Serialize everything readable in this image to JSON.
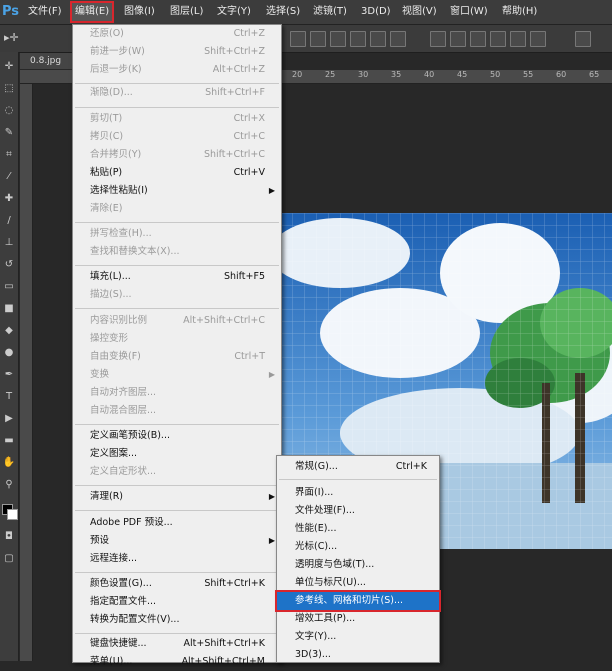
{
  "app_logo": "Ps",
  "menubar": [
    {
      "label": "文件(F)",
      "active": false
    },
    {
      "label": "编辑(E)",
      "active": true
    },
    {
      "label": "图像(I)",
      "active": false
    },
    {
      "label": "图层(L)",
      "active": false
    },
    {
      "label": "文字(Y)",
      "active": false
    },
    {
      "label": "选择(S)",
      "active": false
    },
    {
      "label": "滤镜(T)",
      "active": false
    },
    {
      "label": "3D(D)",
      "active": false
    },
    {
      "label": "视图(V)",
      "active": false
    },
    {
      "label": "窗口(W)",
      "active": false
    },
    {
      "label": "帮助(H)",
      "active": false
    }
  ],
  "document": {
    "tab_label": "0.8.jpg"
  },
  "ruler_ticks": [
    "20",
    "25",
    "30",
    "35",
    "40",
    "45",
    "50",
    "55",
    "60",
    "65"
  ],
  "edit_menu": [
    {
      "label": "还原(O)",
      "shortcut": "Ctrl+Z",
      "disabled": true
    },
    {
      "label": "前进一步(W)",
      "shortcut": "Shift+Ctrl+Z",
      "disabled": true
    },
    {
      "label": "后退一步(K)",
      "shortcut": "Alt+Ctrl+Z",
      "disabled": true
    },
    {
      "sep": true
    },
    {
      "label": "渐隐(D)...",
      "shortcut": "Shift+Ctrl+F",
      "disabled": true
    },
    {
      "sep": true
    },
    {
      "label": "剪切(T)",
      "shortcut": "Ctrl+X",
      "disabled": true
    },
    {
      "label": "拷贝(C)",
      "shortcut": "Ctrl+C",
      "disabled": true
    },
    {
      "label": "合并拷贝(Y)",
      "shortcut": "Shift+Ctrl+C",
      "disabled": true
    },
    {
      "label": "粘贴(P)",
      "shortcut": "Ctrl+V",
      "disabled": false
    },
    {
      "label": "选择性粘贴(I)",
      "shortcut": "",
      "disabled": false,
      "submenu": true
    },
    {
      "label": "清除(E)",
      "shortcut": "",
      "disabled": true
    },
    {
      "sep": true
    },
    {
      "label": "拼写检查(H)...",
      "shortcut": "",
      "disabled": true
    },
    {
      "label": "查找和替换文本(X)...",
      "shortcut": "",
      "disabled": true
    },
    {
      "sep": true
    },
    {
      "label": "填充(L)...",
      "shortcut": "Shift+F5",
      "disabled": false
    },
    {
      "label": "描边(S)...",
      "shortcut": "",
      "disabled": true
    },
    {
      "sep": true
    },
    {
      "label": "内容识别比例",
      "shortcut": "Alt+Shift+Ctrl+C",
      "disabled": true
    },
    {
      "label": "操控变形",
      "shortcut": "",
      "disabled": true
    },
    {
      "label": "自由变换(F)",
      "shortcut": "Ctrl+T",
      "disabled": true
    },
    {
      "label": "变换",
      "shortcut": "",
      "disabled": true,
      "submenu": true
    },
    {
      "label": "自动对齐图层...",
      "shortcut": "",
      "disabled": true
    },
    {
      "label": "自动混合图层...",
      "shortcut": "",
      "disabled": true
    },
    {
      "sep": true
    },
    {
      "label": "定义画笔预设(B)...",
      "shortcut": "",
      "disabled": false
    },
    {
      "label": "定义图案...",
      "shortcut": "",
      "disabled": false
    },
    {
      "label": "定义自定形状...",
      "shortcut": "",
      "disabled": true
    },
    {
      "sep": true
    },
    {
      "label": "清理(R)",
      "shortcut": "",
      "disabled": false,
      "submenu": true
    },
    {
      "sep": true
    },
    {
      "label": "Adobe PDF 预设...",
      "shortcut": "",
      "disabled": false
    },
    {
      "label": "预设",
      "shortcut": "",
      "disabled": false,
      "submenu": true
    },
    {
      "label": "远程连接...",
      "shortcut": "",
      "disabled": false
    },
    {
      "sep": true
    },
    {
      "label": "颜色设置(G)...",
      "shortcut": "Shift+Ctrl+K",
      "disabled": false
    },
    {
      "label": "指定配置文件...",
      "shortcut": "",
      "disabled": false
    },
    {
      "label": "转换为配置文件(V)...",
      "shortcut": "",
      "disabled": false
    },
    {
      "sep": true
    },
    {
      "label": "键盘快捷键...",
      "shortcut": "Alt+Shift+Ctrl+K",
      "disabled": false
    },
    {
      "label": "菜单(U)...",
      "shortcut": "Alt+Shift+Ctrl+M",
      "disabled": false
    }
  ],
  "preferences_submenu": [
    {
      "label": "常规(G)...",
      "shortcut": "Ctrl+K",
      "highlighted": false
    },
    {
      "sep": true
    },
    {
      "label": "界面(I)...",
      "shortcut": "",
      "highlighted": false
    },
    {
      "label": "文件处理(F)...",
      "shortcut": "",
      "highlighted": false
    },
    {
      "label": "性能(E)...",
      "shortcut": "",
      "highlighted": false
    },
    {
      "label": "光标(C)...",
      "shortcut": "",
      "highlighted": false
    },
    {
      "label": "透明度与色域(T)...",
      "shortcut": "",
      "highlighted": false
    },
    {
      "label": "单位与标尺(U)...",
      "shortcut": "",
      "highlighted": false
    },
    {
      "label": "参考线、网格和切片(S)...",
      "shortcut": "",
      "highlighted": true
    },
    {
      "label": "增效工具(P)...",
      "shortcut": "",
      "highlighted": false
    },
    {
      "label": "文字(Y)...",
      "shortcut": "",
      "highlighted": false
    },
    {
      "label": "3D(3)...",
      "shortcut": "",
      "highlighted": false
    }
  ]
}
